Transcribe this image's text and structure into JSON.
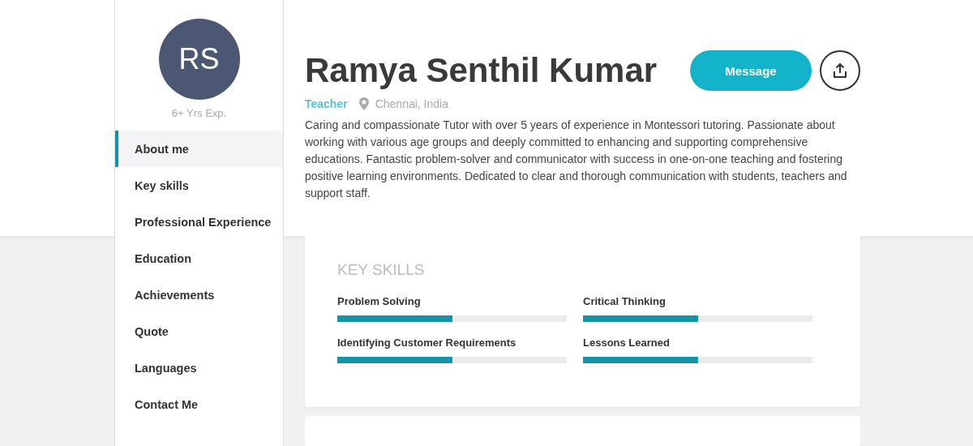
{
  "profile": {
    "initials": "RS",
    "experience": "6+ Yrs Exp.",
    "name": "Ramya Senthil Kumar",
    "role": "Teacher",
    "location": "Chennai, India",
    "bio": "Caring and compassionate Tutor with over 5 years of experience in Montessori tutoring. Passionate about working with various age groups and deeply committed to enhancing and supporting comprehensive educations. Fantastic problem-solver and communicator with success in one-on-one teaching and fostering positive learning environments. Dedicated to clear and thorough communication with students, teachers and support staff."
  },
  "actions": {
    "message": "Message"
  },
  "sidebar": {
    "items": [
      {
        "label": "About me",
        "selected": true
      },
      {
        "label": "Key skills",
        "selected": false
      },
      {
        "label": "Professional Experience",
        "selected": false
      },
      {
        "label": "Education",
        "selected": false
      },
      {
        "label": "Achievements",
        "selected": false
      },
      {
        "label": "Quote",
        "selected": false
      },
      {
        "label": "Languages",
        "selected": false
      },
      {
        "label": "Contact Me",
        "selected": false
      }
    ]
  },
  "key_skills": {
    "title": "KEY SKILLS",
    "skills": [
      {
        "name": "Problem Solving",
        "level": 0.5
      },
      {
        "name": "Critical Thinking",
        "level": 0.5
      },
      {
        "name": "Identifying Customer Requirements",
        "level": 0.5
      },
      {
        "name": "Lessons Learned",
        "level": 0.5
      }
    ]
  }
}
